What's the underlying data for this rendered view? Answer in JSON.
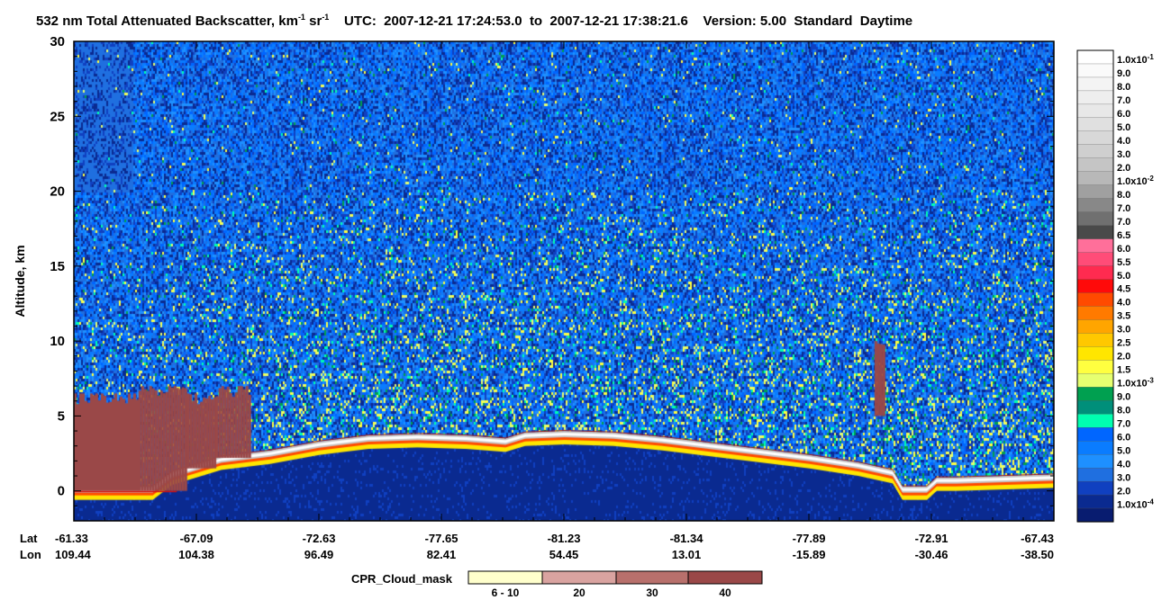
{
  "header": {
    "title_prefix": "532 nm Total Attenuated Backscatter, km",
    "title_exp1": "-1",
    "title_mid": " sr",
    "title_exp2": "-1",
    "title_suffix": "    UTC:  2007-12-21 17:24:53.0  to  2007-12-21 17:38:21.6    Version: 5.00  Standard  Daytime"
  },
  "chart_data": {
    "type": "heatmap",
    "title": "532 nm Total Attenuated Backscatter, km-1 sr-1",
    "time_range": [
      "2007-12-21 17:24:53.0",
      "2007-12-21 17:38:21.6"
    ],
    "version": "Version: 5.00  Standard  Daytime",
    "ylabel": "Altitude, km",
    "ylim": [
      -2,
      30
    ],
    "yticks": [
      0,
      5,
      10,
      15,
      20,
      25,
      30
    ],
    "x_row_labels": [
      "Lat",
      "Lon"
    ],
    "xticks": [
      {
        "lat": "-61.33",
        "lon": "109.44"
      },
      {
        "lat": "-67.09",
        "lon": "104.38"
      },
      {
        "lat": "-72.63",
        "lon": "96.49"
      },
      {
        "lat": "-77.65",
        "lon": "82.41"
      },
      {
        "lat": "-81.23",
        "lon": "54.45"
      },
      {
        "lat": "-81.34",
        "lon": "13.01"
      },
      {
        "lat": "-77.89",
        "lon": "-15.89"
      },
      {
        "lat": "-72.91",
        "lon": "-30.46"
      },
      {
        "lat": "-67.43",
        "lon": "-38.50"
      }
    ],
    "surface_altitude_km": [
      [
        0.0,
        0.0
      ],
      [
        0.08,
        0.0
      ],
      [
        0.1,
        1.0
      ],
      [
        0.15,
        2.0
      ],
      [
        0.2,
        2.4
      ],
      [
        0.25,
        3.0
      ],
      [
        0.3,
        3.4
      ],
      [
        0.35,
        3.5
      ],
      [
        0.4,
        3.4
      ],
      [
        0.44,
        3.2
      ],
      [
        0.46,
        3.6
      ],
      [
        0.5,
        3.7
      ],
      [
        0.55,
        3.6
      ],
      [
        0.6,
        3.3
      ],
      [
        0.65,
        2.9
      ],
      [
        0.7,
        2.5
      ],
      [
        0.75,
        2.1
      ],
      [
        0.8,
        1.6
      ],
      [
        0.835,
        1.1
      ],
      [
        0.845,
        0.0
      ],
      [
        0.87,
        0.0
      ],
      [
        0.88,
        0.6
      ],
      [
        0.9,
        0.6
      ],
      [
        0.95,
        0.7
      ],
      [
        1.0,
        0.8
      ]
    ],
    "cloud_mask_regions": [
      {
        "x0": 0.0,
        "x1": 0.066,
        "y0": 0.0,
        "y1": 6.5,
        "value": 40
      },
      {
        "x0": 0.066,
        "x1": 0.115,
        "y0": 0.0,
        "y1": 7.0,
        "value": 40
      },
      {
        "x0": 0.115,
        "x1": 0.145,
        "y0": 1.5,
        "y1": 6.5,
        "value": 40
      },
      {
        "x0": 0.145,
        "x1": 0.18,
        "y0": 2.2,
        "y1": 7.0,
        "value": 40
      },
      {
        "x0": 0.817,
        "x1": 0.827,
        "y0": 5.0,
        "y1": 10.0,
        "value": 40
      }
    ],
    "colorbar": {
      "labels": [
        "1.0x10-1",
        "9.0",
        "8.0",
        "7.0",
        "6.0",
        "5.0",
        "4.0",
        "3.0",
        "2.0",
        "1.0x10-2",
        "8.0",
        "7.0",
        "7.0",
        "6.5",
        "6.0",
        "5.5",
        "5.0",
        "4.5",
        "4.0",
        "3.5",
        "3.0",
        "2.5",
        "2.0",
        "1.5",
        "1.0x10-3",
        "9.0",
        "8.0",
        "7.0",
        "6.0",
        "5.0",
        "4.0",
        "3.0",
        "2.0",
        "1.0x10-4"
      ],
      "colors": [
        "#ffffff",
        "#fafafa",
        "#f4f4f4",
        "#eeeeee",
        "#e8e8e8",
        "#e0e0e0",
        "#d8d8d8",
        "#cfcfcf",
        "#c5c5c5",
        "#b8b8b8",
        "#a0a0a0",
        "#888888",
        "#707070",
        "#4a4a4a",
        "#ff6f9a",
        "#ff4c78",
        "#ff2b50",
        "#ff0a0a",
        "#ff4a00",
        "#ff7a00",
        "#ffa500",
        "#ffc800",
        "#ffe600",
        "#ffff40",
        "#e6ff70",
        "#00a050",
        "#008f7a",
        "#00ffb0",
        "#0066ff",
        "#0a7cff",
        "#1e90ff",
        "#1f6fe0",
        "#1040c0",
        "#0a2a90",
        "#081c70"
      ]
    },
    "cloud_mask_legend": {
      "title": "CPR_Cloud_mask",
      "labels": [
        "6 - 10",
        "20",
        "30",
        "40"
      ],
      "colors": [
        "#ffffcc",
        "#d9a3a0",
        "#b8706c",
        "#9a4848"
      ]
    }
  }
}
